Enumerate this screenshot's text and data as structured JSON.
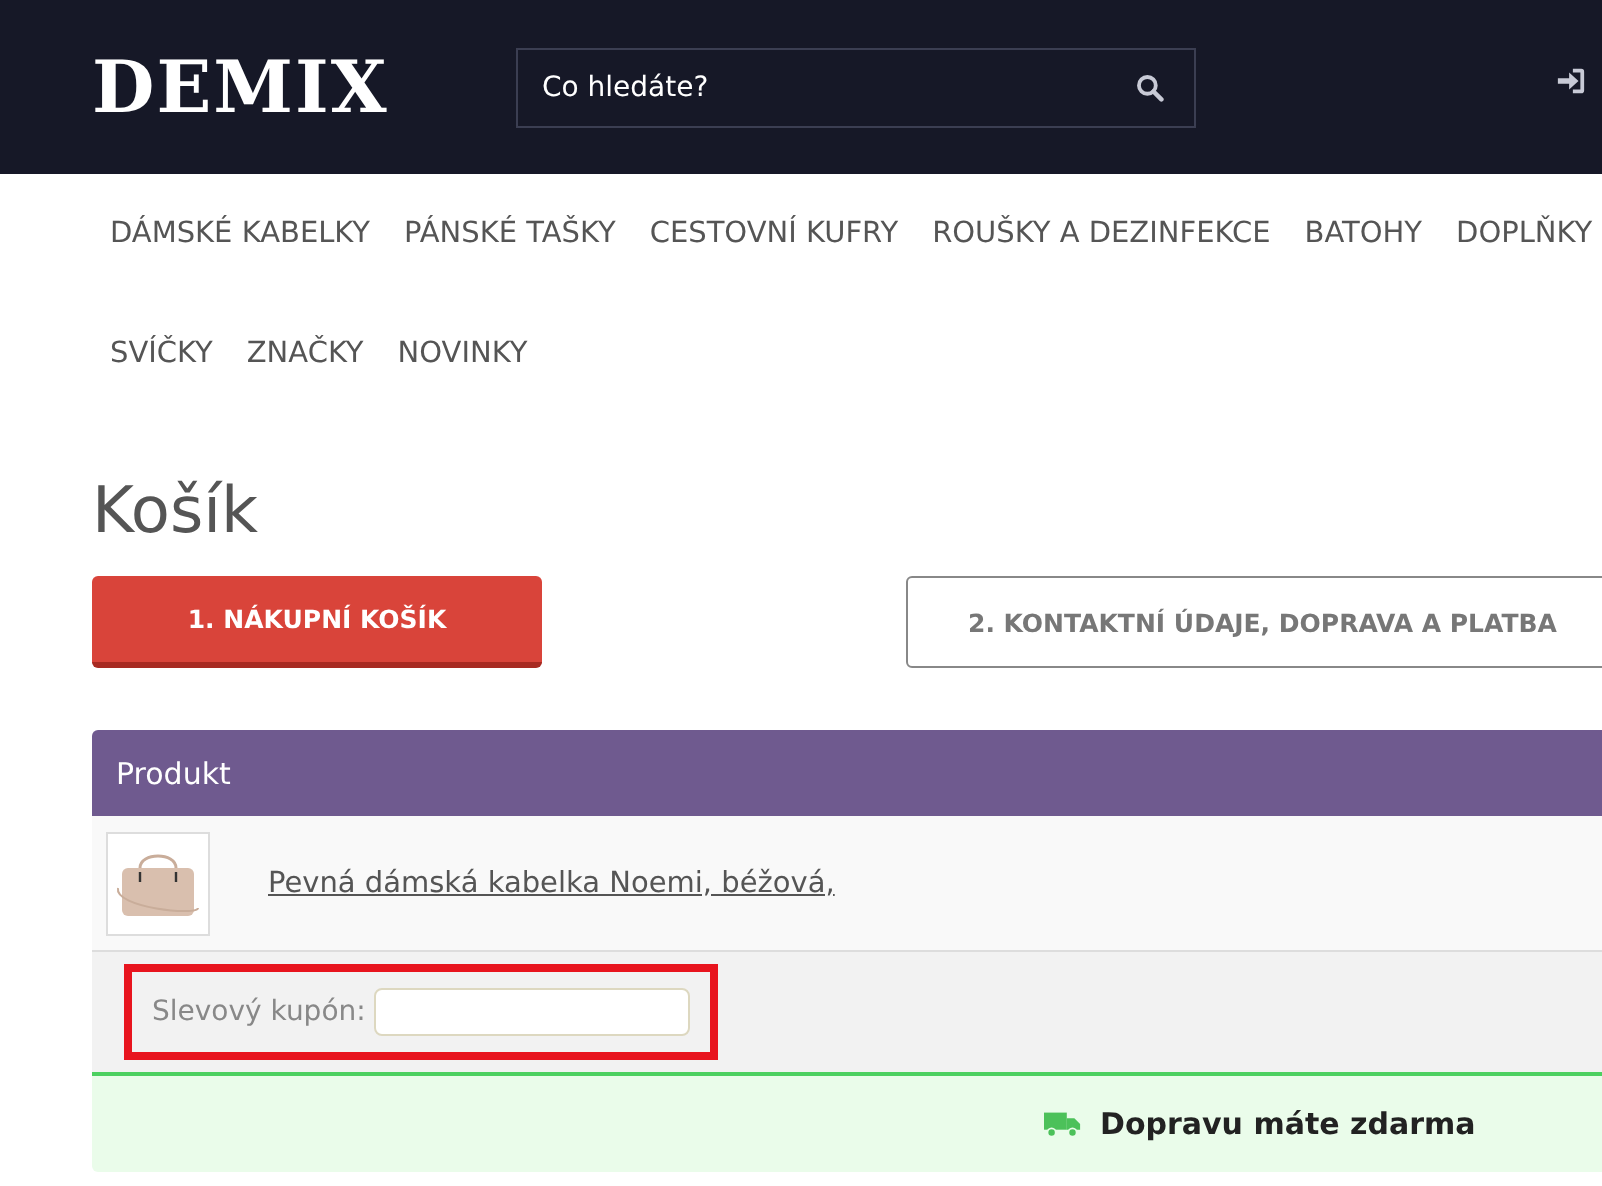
{
  "header": {
    "logo": "DEMIX",
    "search": {
      "placeholder": "Co hledáte?"
    }
  },
  "nav": {
    "items": [
      "DÁMSKÉ KABELKY",
      "PÁNSKÉ TAŠKY",
      "CESTOVNÍ KUFRY",
      "ROUŠKY A DEZINFEKCE",
      "BATOHY",
      "DOPLŇKY",
      "SVÍČKY",
      "ZNAČKY",
      "NOVINKY"
    ]
  },
  "page_title": "Košík",
  "steps": [
    {
      "label": "1. NÁKUPNÍ KOŠÍK",
      "selected": true
    },
    {
      "label": "2. KONTAKTNÍ ÚDAJE, DOPRAVA A PLATBA",
      "selected": false
    }
  ],
  "cart": {
    "columns": [
      "Produkt"
    ],
    "rows": [
      {
        "product": "Pevná dámská kabelka Noemi, béžová,"
      }
    ],
    "coupon": {
      "label": "Slevový kupón:",
      "highlighted": true
    },
    "shipping_note": "Dopravu máte zdarma"
  }
}
